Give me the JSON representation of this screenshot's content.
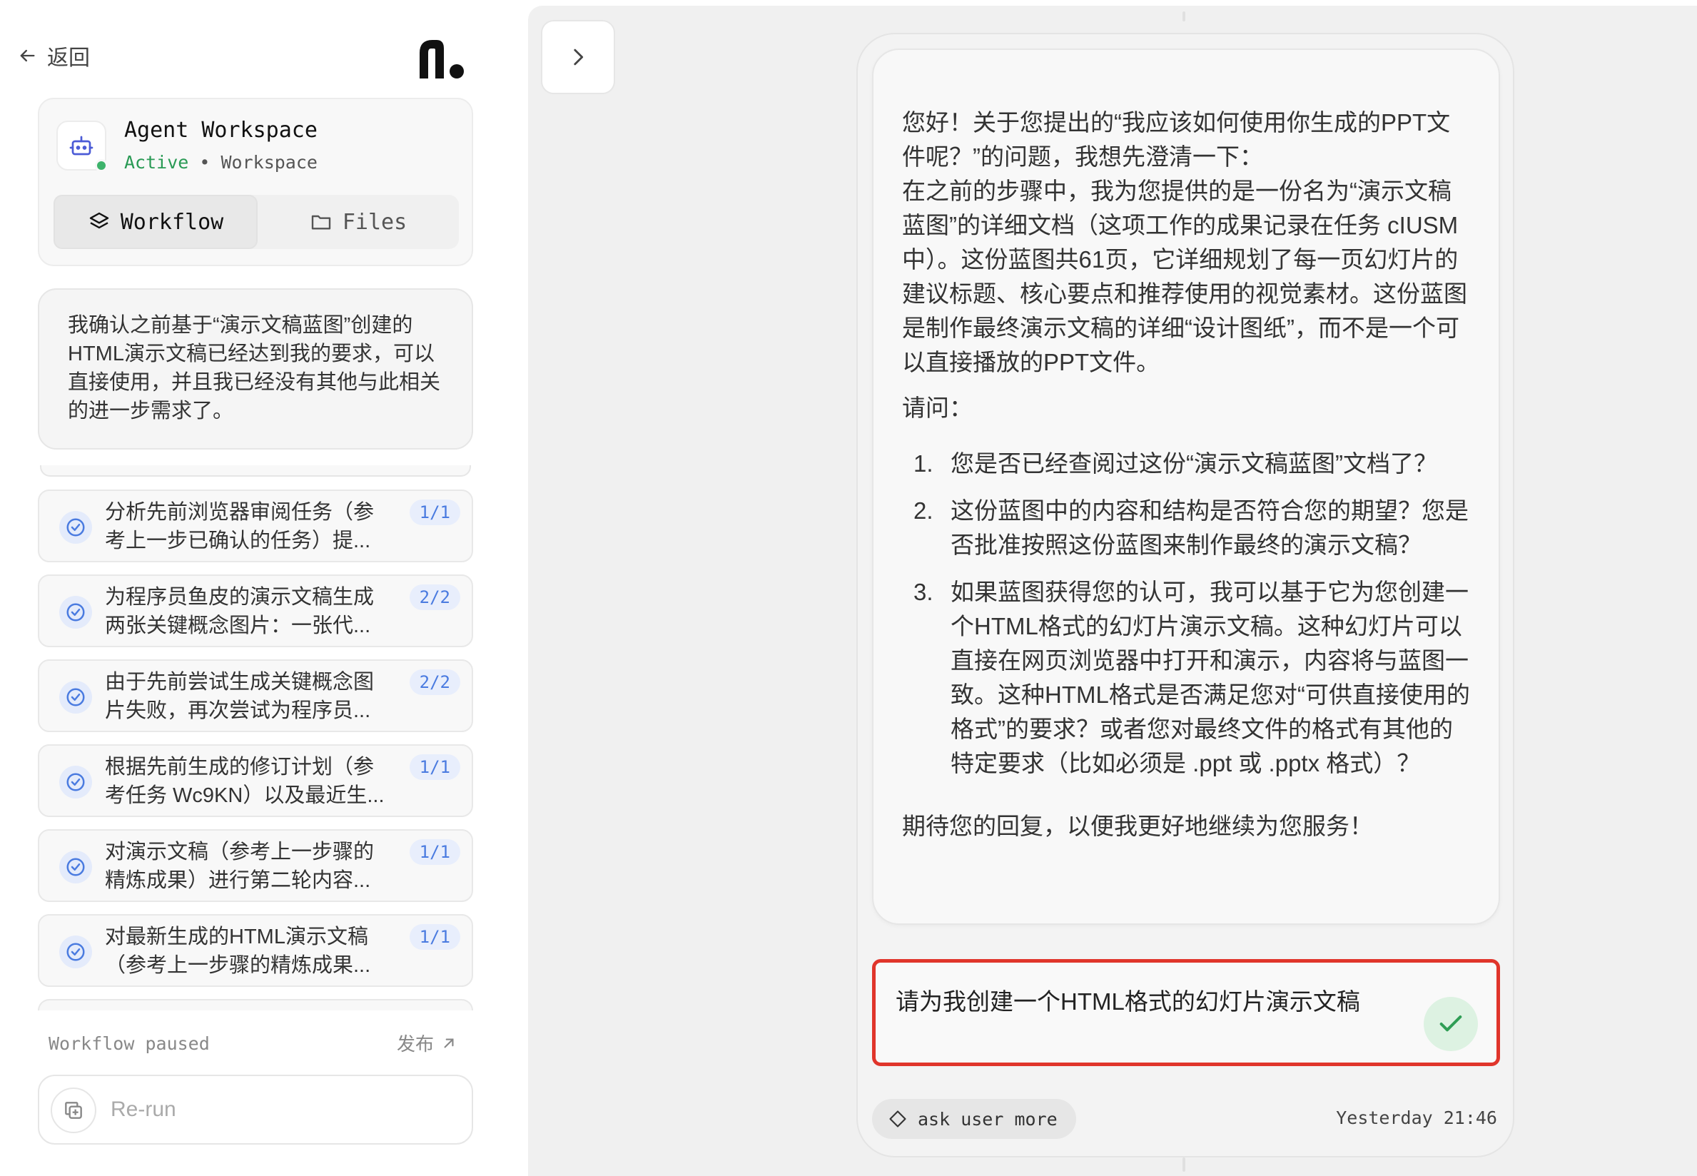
{
  "sidebar": {
    "back_label": "返回",
    "agent": {
      "name": "Agent Workspace",
      "status": "Active",
      "separator": "•",
      "type": "Workspace",
      "status_color": "#2a9a55"
    },
    "tabs": [
      {
        "label": "Workflow",
        "icon": "layers-icon",
        "selected": true
      },
      {
        "label": "Files",
        "icon": "folder-icon",
        "selected": false
      }
    ],
    "user_message": "我确认之前基于“演示文稿蓝图”创建的HTML演示文稿已经达到我的要求，可以直接使用，并且我已经没有其他与此相关的进一步需求了。",
    "tasks": [
      {
        "text": "分析先前浏览器审阅任务（参考上一步已确认的任务）提...",
        "badge": "1/1"
      },
      {
        "text": "为程序员鱼皮的演示文稿生成两张关键概念图片：一张代...",
        "badge": "2/2"
      },
      {
        "text": "由于先前尝试生成关键概念图片失败，再次尝试为程序员...",
        "badge": "2/2"
      },
      {
        "text": "根据先前生成的修订计划（参考任务 Wc9KN）以及最近生...",
        "badge": "1/1"
      },
      {
        "text": "对演示文稿（参考上一步骤的精炼成果）进行第二轮内容...",
        "badge": "1/1"
      },
      {
        "text": "对最新生成的HTML演示文稿（参考上一步骤的精炼成果...",
        "badge": "1/1"
      }
    ],
    "workflow_status": "Workflow paused",
    "publish_label": "发布",
    "rerun_label": "Re-run"
  },
  "main": {
    "assistant_message": {
      "intro_lines": [
        "您好！关于您提出的“我应该如何使用你生成的PPT文件呢？”的问题，我想先澄清一下：",
        "在之前的步骤中，我为您提供的是一份名为“演示文稿蓝图”的详细文档（这项工作的成果记录在任务 cIUSM 中）。这份蓝图共61页，它详细规划了每一页幻灯片的建议标题、核心要点和推荐使用的视觉素材。这份蓝图是制作最终演示文稿的详细“设计图纸”，而不是一个可以直接播放的PPT文件。"
      ],
      "question_label": "请问：",
      "questions": [
        {
          "num": "1.",
          "text": "您是否已经查阅过这份“演示文稿蓝图”文档了？"
        },
        {
          "num": "2.",
          "text": "这份蓝图中的内容和结构是否符合您的期望？您是否批准按照这份蓝图来制作最终的演示文稿？"
        },
        {
          "num": "3.",
          "text": "如果蓝图获得您的认可，我可以基于它为您创建一个HTML格式的幻灯片演示文稿。这种幻灯片可以直接在网页浏览器中打开和演示，内容将与蓝图一致。这种HTML格式是否满足您对“可供直接使用的格式”的要求？或者您对最终文件的格式有其他的特定要求（比如必须是 .ppt 或 .pptx 格式）？"
        }
      ],
      "closing": "期待您的回复，以便我更好地继续为您服务！"
    },
    "user_reply": "请为我创建一个HTML格式的幻灯片演示文稿",
    "tag_label": "ask user more",
    "timestamp": "Yesterday 21:46",
    "highlight_color": "#e0352b",
    "accent_color": "#4a7be0"
  }
}
